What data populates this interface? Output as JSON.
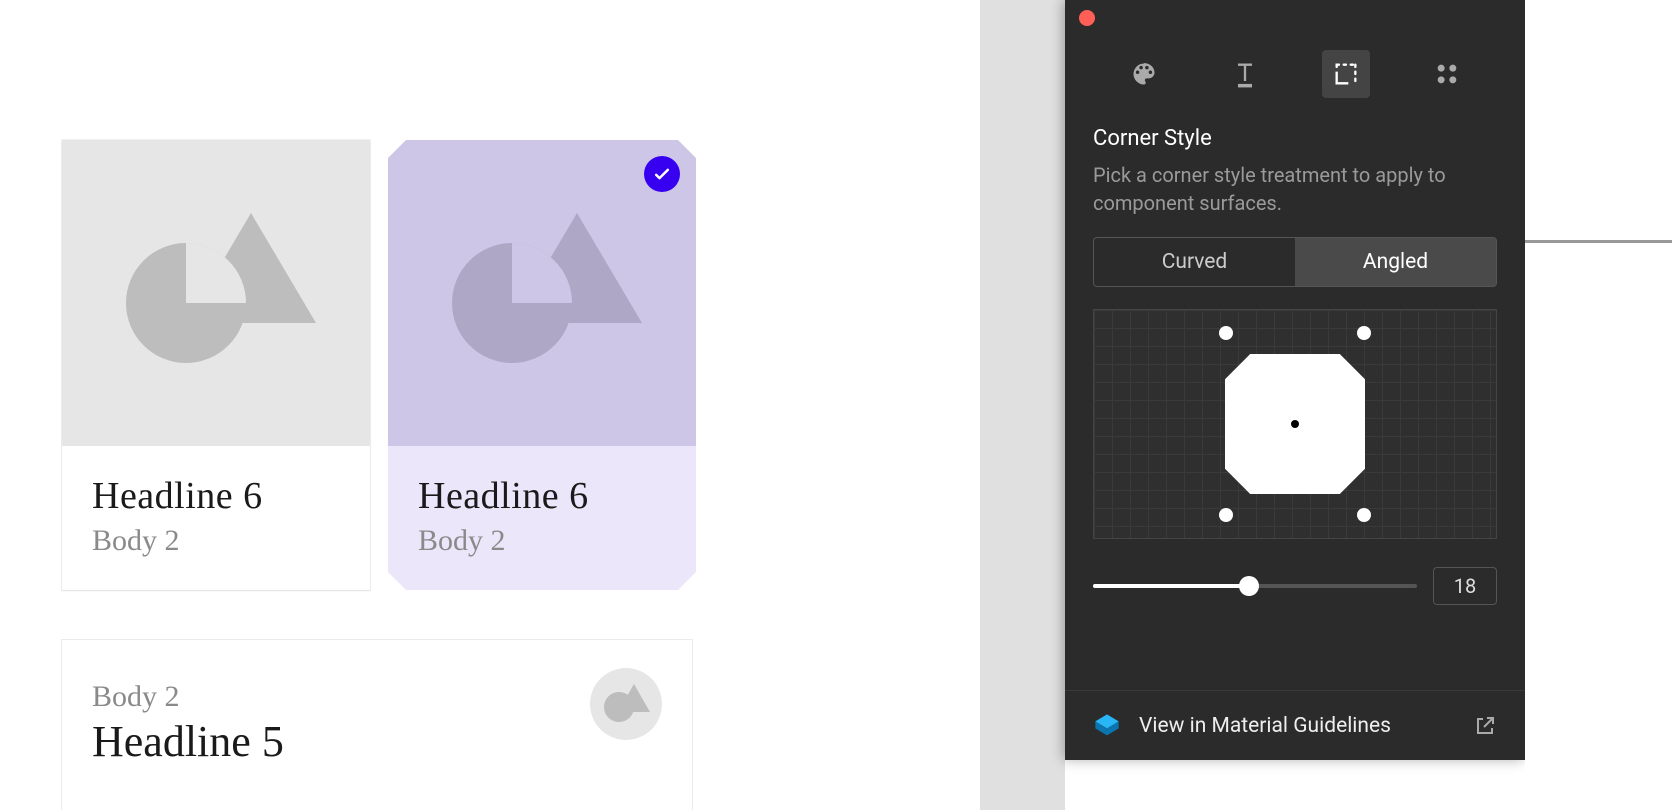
{
  "cards": [
    {
      "headline": "Headline 6",
      "body": "Body 2",
      "selected": false
    },
    {
      "headline": "Headline 6",
      "body": "Body 2",
      "selected": true
    }
  ],
  "card3": {
    "body": "Body 2",
    "headline": "Headline 5"
  },
  "panel": {
    "section_title": "Corner Style",
    "section_desc": "Pick a corner style treatment to apply to component surfaces.",
    "segments": {
      "curved": "Curved",
      "angled": "Angled",
      "active": "angled"
    },
    "slider_value": "18",
    "footer_link": "View in Material Guidelines"
  }
}
